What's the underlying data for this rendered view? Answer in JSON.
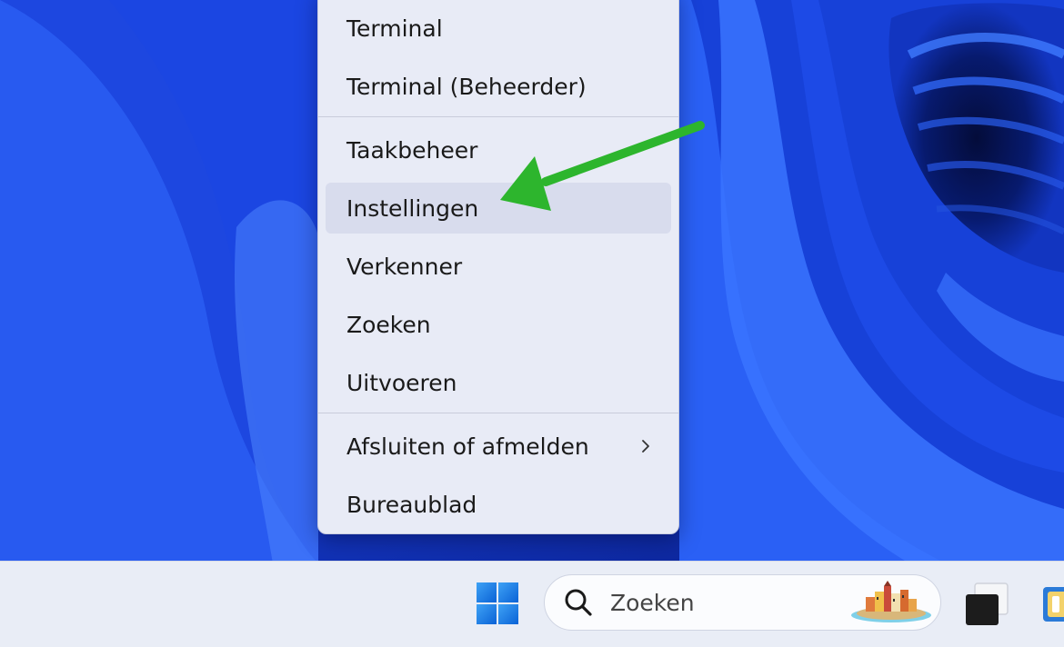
{
  "menu": {
    "items": [
      {
        "label": "Terminal"
      },
      {
        "label": "Terminal (Beheerder)"
      },
      {
        "label": "Taakbeheer"
      },
      {
        "label": "Instellingen"
      },
      {
        "label": "Verkenner"
      },
      {
        "label": "Zoeken"
      },
      {
        "label": "Uitvoeren"
      },
      {
        "label": "Afsluiten of afmelden"
      },
      {
        "label": "Bureaublad"
      }
    ],
    "highlighted_item": "Instellingen",
    "submenu_chevron_icon": "chevron-right-icon"
  },
  "annotation": {
    "arrow_color": "#2db52d"
  },
  "taskbar": {
    "start_icon": "windows-logo-icon",
    "search": {
      "placeholder": "Zoeken",
      "icon": "search-icon"
    },
    "task_view_icon": "task-view-icon",
    "explorer_icon": "file-explorer-icon"
  },
  "colors": {
    "wallpaper_blue": "#1b3fd1",
    "menu_bg": "#e8ebf6",
    "taskbar_bg": "#e9edf6",
    "windows_blue": "#0a6ddc"
  }
}
